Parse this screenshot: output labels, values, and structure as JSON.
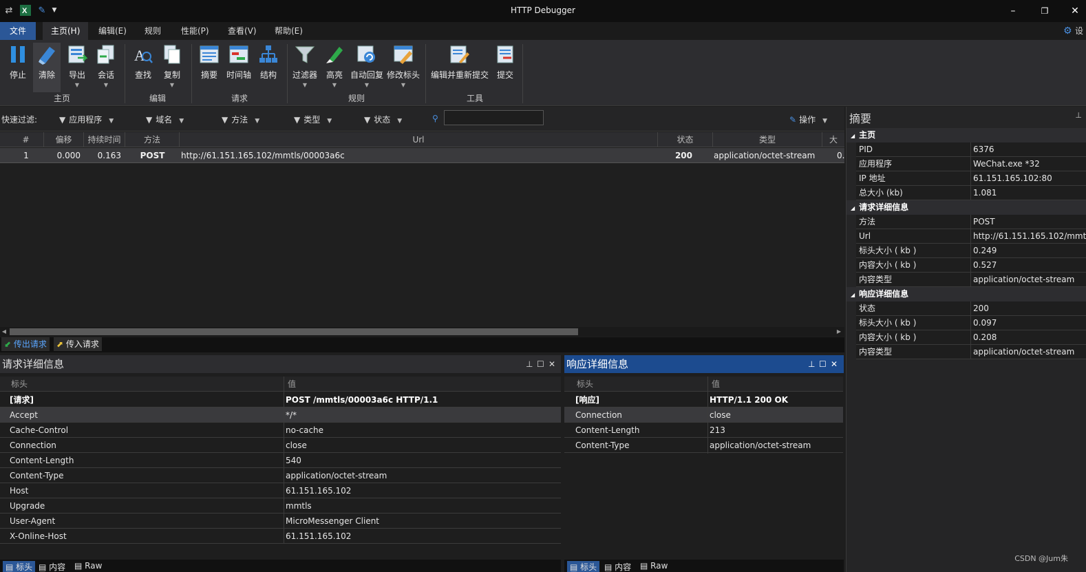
{
  "window": {
    "title": "HTTP Debugger",
    "minimize": "–",
    "restore": "❐",
    "close": "✕",
    "qa_icons": [
      "refresh-icon",
      "excel-icon",
      "brush-icon",
      "dropdown-icon"
    ]
  },
  "menu": {
    "file": "文件",
    "items": [
      "主页(H)",
      "编辑(E)",
      "规则",
      "性能(P)",
      "查看(V)",
      "帮助(E)"
    ],
    "settings": "设"
  },
  "ribbon": {
    "buttons": [
      "停止",
      "清除",
      "导出",
      "会话",
      "查找",
      "复制",
      "摘要",
      "时间轴",
      "结构",
      "过滤器",
      "高亮",
      "自动回复",
      "修改标头",
      "编辑并重新提交",
      "提交"
    ],
    "groups": [
      "主页",
      "编辑",
      "请求",
      "规则",
      "工具"
    ]
  },
  "filter": {
    "label": "快速过滤:",
    "items": [
      "应用程序",
      "域名",
      "方法",
      "类型",
      "状态"
    ],
    "action": "操作",
    "search_value": ""
  },
  "grid": {
    "columns": [
      "#",
      "偏移",
      "持续时间",
      "方法",
      "Url",
      "状态",
      "类型",
      "大"
    ],
    "rows": [
      {
        "num": "1",
        "offset": "0.000",
        "duration": "0.163",
        "method": "POST",
        "url": "http://61.151.165.102/mmtls/00003a6c",
        "status": "200",
        "type": "application/octet-stream",
        "size": "0."
      }
    ]
  },
  "flow_tabs": [
    "传出请求",
    "传入请求"
  ],
  "request_panel": {
    "title": "请求详细信息",
    "col_key": "标头",
    "col_value": "值",
    "first": {
      "key": "[请求]",
      "value": "POST /mmtls/00003a6c HTTP/1.1"
    },
    "headers": [
      {
        "key": "Accept",
        "value": "*/*"
      },
      {
        "key": "Cache-Control",
        "value": "no-cache"
      },
      {
        "key": "Connection",
        "value": "close"
      },
      {
        "key": "Content-Length",
        "value": "540"
      },
      {
        "key": "Content-Type",
        "value": "application/octet-stream"
      },
      {
        "key": "Host",
        "value": "61.151.165.102"
      },
      {
        "key": "Upgrade",
        "value": "mmtls"
      },
      {
        "key": "User-Agent",
        "value": "MicroMessenger Client"
      },
      {
        "key": "X-Online-Host",
        "value": "61.151.165.102"
      }
    ],
    "subtabs": [
      "标头",
      "内容",
      "Raw"
    ]
  },
  "response_panel": {
    "title": "响应详细信息",
    "col_key": "标头",
    "col_value": "值",
    "first": {
      "key": "[响应]",
      "value": "HTTP/1.1 200 OK"
    },
    "headers": [
      {
        "key": "Connection",
        "value": "close"
      },
      {
        "key": "Content-Length",
        "value": "213"
      },
      {
        "key": "Content-Type",
        "value": "application/octet-stream"
      }
    ],
    "subtabs": [
      "标头",
      "内容",
      "Raw"
    ]
  },
  "summary": {
    "title": "摘要",
    "sections": [
      {
        "name": "主页",
        "rows": [
          {
            "key": "PID",
            "value": "6376"
          },
          {
            "key": "应用程序",
            "value": "WeChat.exe *32"
          },
          {
            "key": "IP 地址",
            "value": "61.151.165.102:80"
          },
          {
            "key": "总大小 (kb)",
            "value": "1.081"
          }
        ]
      },
      {
        "name": "请求详细信息",
        "rows": [
          {
            "key": "方法",
            "value": "POST"
          },
          {
            "key": "Url",
            "value": "http://61.151.165.102/mmtl"
          },
          {
            "key": "标头大小 ( kb )",
            "value": "0.249"
          },
          {
            "key": "内容大小 ( kb )",
            "value": "0.527"
          },
          {
            "key": "内容类型",
            "value": "application/octet-stream"
          }
        ]
      },
      {
        "name": "响应详细信息",
        "rows": [
          {
            "key": "状态",
            "value": "200"
          },
          {
            "key": "标头大小 ( kb )",
            "value": "0.097"
          },
          {
            "key": "内容大小 ( kb )",
            "value": "0.208"
          },
          {
            "key": "内容类型",
            "value": "application/octet-stream"
          }
        ]
      }
    ]
  },
  "watermark": "CSDN @Jum朱",
  "colors": {
    "accent": "#2b5797",
    "active_panel": "#1c4b8f",
    "background": "#1e1e1e"
  }
}
